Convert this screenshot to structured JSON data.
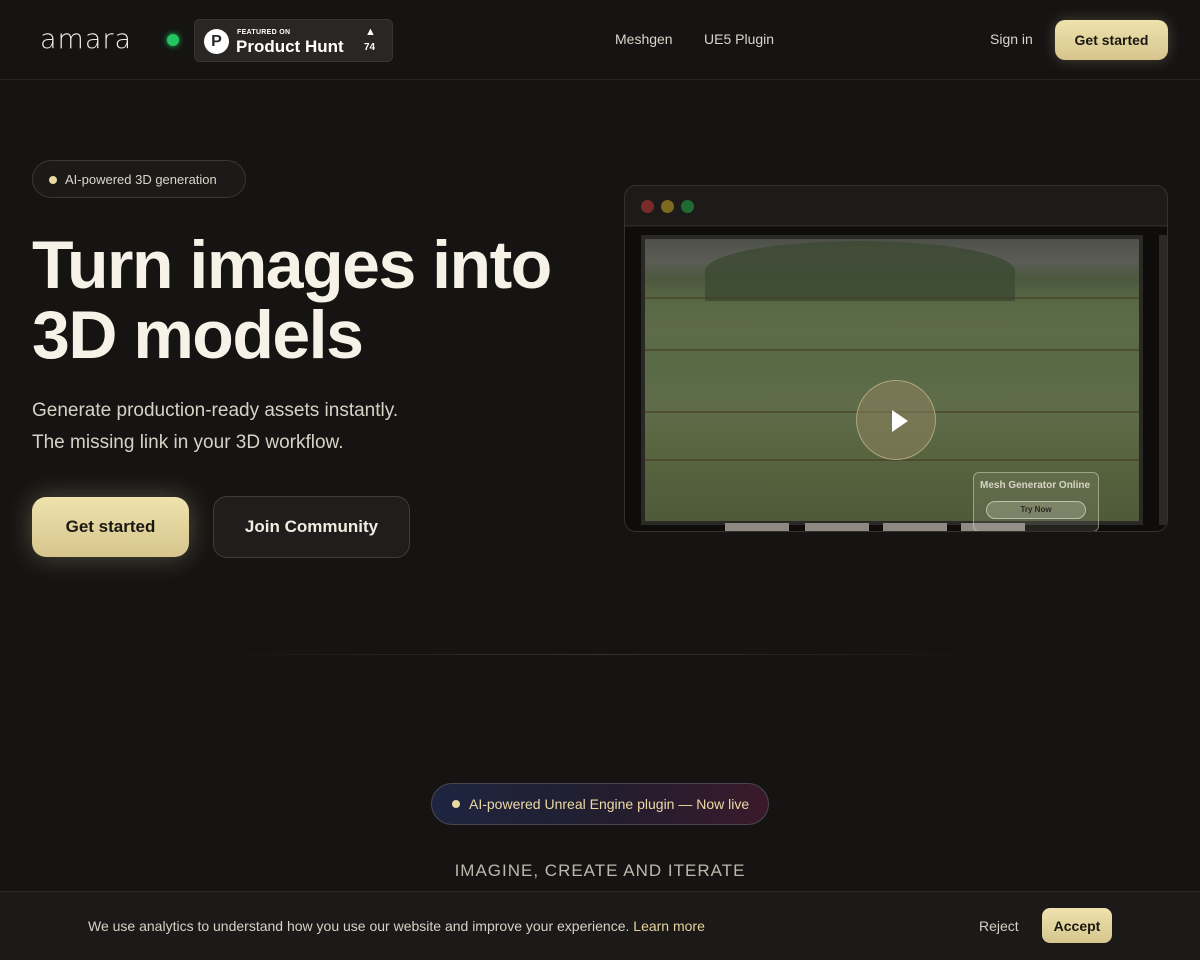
{
  "nav": {
    "logo": "amara",
    "product_hunt": {
      "featured_on": "FEATURED ON",
      "name": "Product Hunt",
      "letter": "P",
      "count": "74",
      "arrow": "▲"
    },
    "links": [
      "Meshgen",
      "UE5 Plugin"
    ],
    "sign_in": "Sign in",
    "cta": "Get started"
  },
  "hero": {
    "badge": "AI-powered 3D generation",
    "title_line1": "Turn images into",
    "title_line2": "3D models",
    "subtitle_line1": "Generate production-ready assets instantly.",
    "subtitle_line2": "The missing link in your 3D workflow.",
    "primary_cta": "Get started",
    "secondary_cta": "Join Community"
  },
  "video": {
    "overlay_title": "Mesh Generator Online",
    "overlay_button": "Try Now"
  },
  "plugin": {
    "badge": "AI-powered Unreal Engine plugin — Now live",
    "tagline": "IMAGINE, CREATE AND ITERATE"
  },
  "cookie": {
    "text": "We use analytics to understand how you use our website and improve your experience.",
    "link": "Learn more",
    "reject": "Reject",
    "accept": "Accept"
  },
  "colors": {
    "background": "#151413",
    "accent_gold": "#e6d5a0",
    "status_green": "#22c55e"
  }
}
